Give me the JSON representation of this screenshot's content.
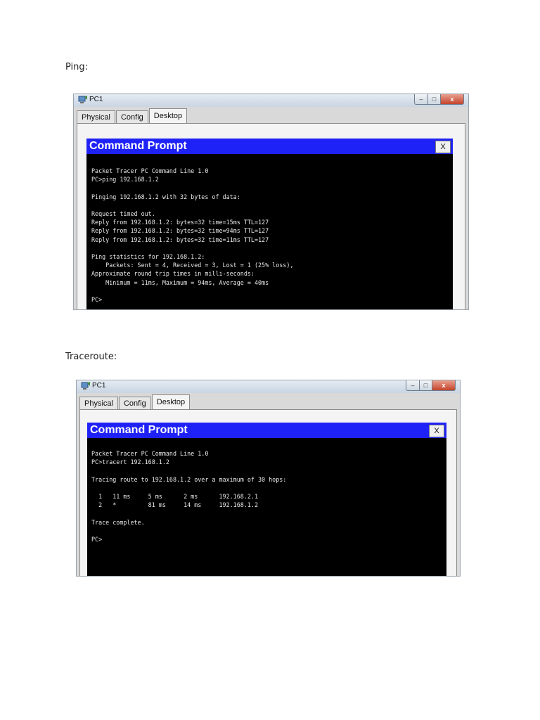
{
  "ping_section": {
    "label": "Ping:",
    "window": {
      "title": "PC1",
      "controls": {
        "minimize": "–",
        "maximize": "□",
        "close": "x"
      },
      "tabs": [
        "Physical",
        "Config",
        "Desktop"
      ],
      "active_tab": "Desktop",
      "command_prompt": {
        "title": "Command Prompt",
        "close_label": "X",
        "lines": [
          "Packet Tracer PC Command Line 1.0",
          "PC>ping 192.168.1.2",
          "",
          "Pinging 192.168.1.2 with 32 bytes of data:",
          "",
          "Request timed out.",
          "Reply from 192.168.1.2: bytes=32 time=15ms TTL=127",
          "Reply from 192.168.1.2: bytes=32 time=94ms TTL=127",
          "Reply from 192.168.1.2: bytes=32 time=11ms TTL=127",
          "",
          "Ping statistics for 192.168.1.2:",
          "    Packets: Sent = 4, Received = 3, Lost = 1 (25% loss),",
          "Approximate round trip times in milli-seconds:",
          "    Minimum = 11ms, Maximum = 94ms, Average = 40ms",
          "",
          "PC>"
        ]
      }
    }
  },
  "traceroute_section": {
    "label": "Traceroute:",
    "window": {
      "title": "PC1",
      "controls": {
        "minimize": "–",
        "maximize": "□",
        "close": "x"
      },
      "tabs": [
        "Physical",
        "Config",
        "Desktop"
      ],
      "active_tab": "Desktop",
      "command_prompt": {
        "title": "Command Prompt",
        "close_label": "X",
        "lines": [
          "Packet Tracer PC Command Line 1.0",
          "PC>tracert 192.168.1.2",
          "",
          "Tracing route to 192.168.1.2 over a maximum of 30 hops:",
          "",
          "  1   11 ms     5 ms      2 ms      192.168.2.1",
          "  2   *         81 ms     14 ms     192.168.1.2",
          "",
          "Trace complete.",
          "",
          "PC>"
        ]
      }
    }
  },
  "colors": {
    "command_prompt_header": "#1f22f6",
    "console_background": "#000000",
    "console_text": "#e8e8e8"
  }
}
